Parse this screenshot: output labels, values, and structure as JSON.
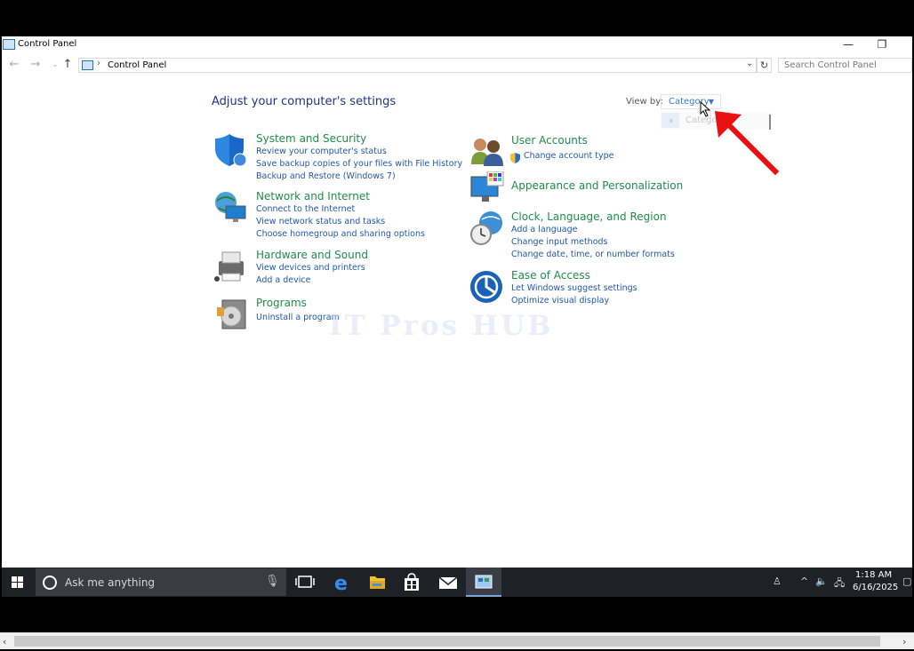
{
  "window": {
    "title": "Control Panel",
    "minimize_glyph": "—",
    "restore_glyph": "❐"
  },
  "nav": {
    "back_icon": "back-arrow-icon",
    "forward_icon": "forward-arrow-icon",
    "up_icon": "up-arrow-icon",
    "address": "Control Panel",
    "search_placeholder": "Search Control Panel"
  },
  "main": {
    "heading": "Adjust your computer's settings",
    "view_by_label": "View by:",
    "view_by_value": "Category",
    "dropdown_option": "Catego"
  },
  "categories": [
    {
      "title": "System and Security",
      "icon": "shield-icon",
      "links": [
        "Review your computer's status",
        "Save backup copies of your files with File History",
        "Backup and Restore (Windows 7)"
      ]
    },
    {
      "title": "Network and Internet",
      "icon": "network-globe-icon",
      "links": [
        "Connect to the Internet",
        "View network status and tasks",
        "Choose homegroup and sharing options"
      ]
    },
    {
      "title": "Hardware and Sound",
      "icon": "printer-icon",
      "links": [
        "View devices and printers",
        "Add a device"
      ]
    },
    {
      "title": "Programs",
      "icon": "programs-disc-icon",
      "links": [
        "Uninstall a program"
      ]
    },
    {
      "title": "User Accounts",
      "icon": "users-icon",
      "links": [
        "Change account type"
      ]
    },
    {
      "title": "Appearance and Personalization",
      "icon": "display-palette-icon",
      "links": []
    },
    {
      "title": "Clock, Language, and Region",
      "icon": "clock-globe-icon",
      "links": [
        "Add a language",
        "Change input methods",
        "Change date, time, or number formats"
      ]
    },
    {
      "title": "Ease of Access",
      "icon": "ease-of-access-icon",
      "links": [
        "Let Windows suggest settings",
        "Optimize visual display"
      ]
    }
  ],
  "watermark": "IT Pros HUB",
  "taskbar": {
    "search_placeholder": "Ask me anything",
    "time": "1:18 AM",
    "date": "6/16/2025"
  },
  "colors": {
    "category_title": "#1f8c4b",
    "link": "#2159a8",
    "heading": "#1e3287",
    "taskbar": "#1f2127",
    "annotation_arrow": "#e81010"
  }
}
